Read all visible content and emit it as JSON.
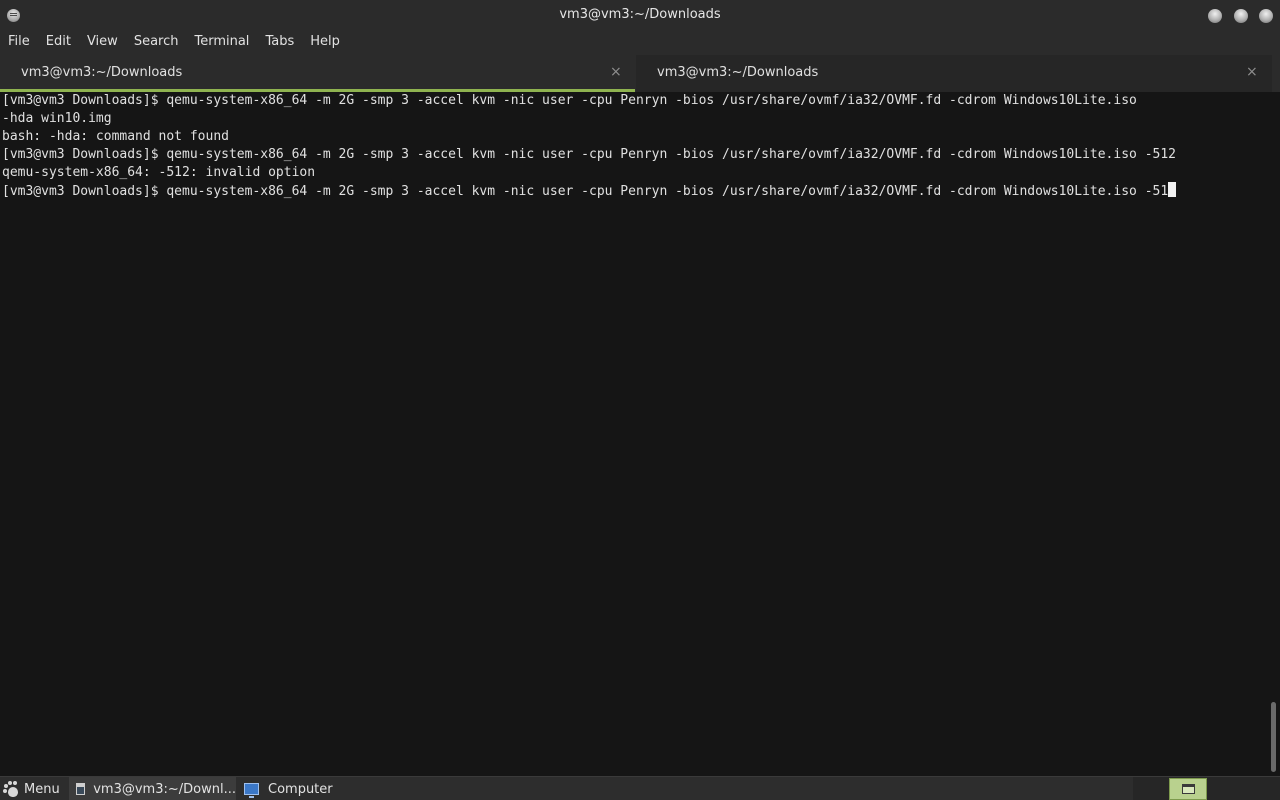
{
  "window": {
    "title": "vm3@vm3:~/Downloads",
    "menu_icon": "window-menu-icon",
    "controls": [
      "minimize-icon",
      "maximize-icon",
      "close-icon"
    ]
  },
  "menubar": {
    "items": [
      "File",
      "Edit",
      "View",
      "Search",
      "Terminal",
      "Tabs",
      "Help"
    ]
  },
  "tabs": [
    {
      "label": "vm3@vm3:~/Downloads",
      "close": "×",
      "active": true
    },
    {
      "label": "vm3@vm3:~/Downloads",
      "close": "×",
      "active": false
    }
  ],
  "terminal": {
    "lines": [
      "[vm3@vm3 Downloads]$ qemu-system-x86_64 -m 2G -smp 3 -accel kvm -nic user -cpu Penryn -bios /usr/share/ovmf/ia32/OVMF.fd -cdrom Windows10Lite.iso",
      "-hda win10.img",
      "bash: -hda: command not found",
      "[vm3@vm3 Downloads]$ qemu-system-x86_64 -m 2G -smp 3 -accel kvm -nic user -cpu Penryn -bios /usr/share/ovmf/ia32/OVMF.fd -cdrom Windows10Lite.iso -512",
      "qemu-system-x86_64: -512: invalid option"
    ],
    "current_line": "[vm3@vm3 Downloads]$ qemu-system-x86_64 -m 2G -smp 3 -accel kvm -nic user -cpu Penryn -bios /usr/share/ovmf/ia32/OVMF.fd -cdrom Windows10Lite.iso -51"
  },
  "panel": {
    "menu_label": "Menu",
    "tasks": [
      {
        "label": "vm3@vm3:~/Downl...",
        "icon": "terminal-icon",
        "active": true
      },
      {
        "label": "Computer",
        "icon": "computer-icon",
        "active": false
      }
    ],
    "workspaces": {
      "count": 1,
      "active": 1
    }
  },
  "colors": {
    "accent": "#8fb350",
    "terminal_bg": "#151515",
    "chrome_bg": "#2b2b2b"
  }
}
